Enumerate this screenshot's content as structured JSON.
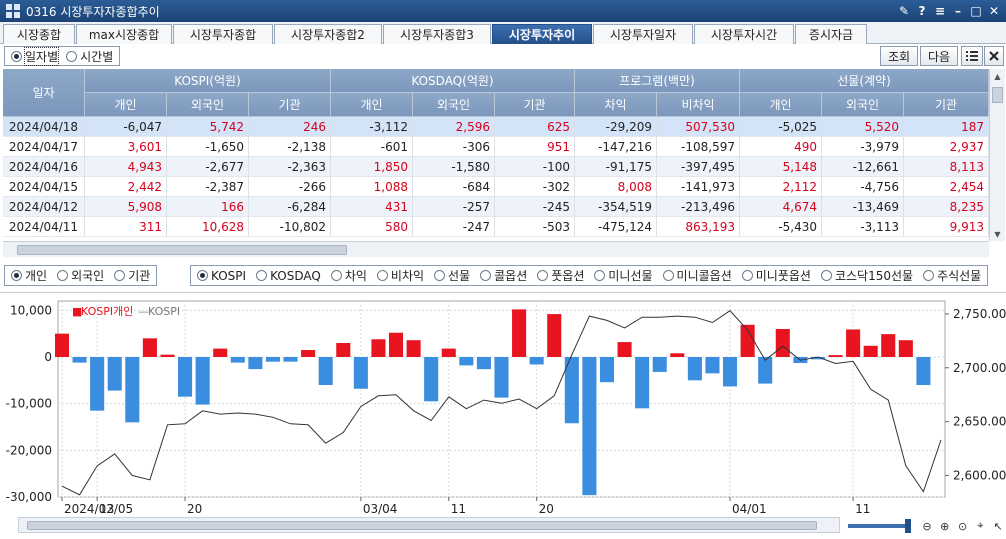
{
  "window": {
    "title": "0316 시장투자자종합추이",
    "buttons": [
      "✎",
      "?",
      "≡",
      "–",
      "□",
      "✕"
    ]
  },
  "tabs": [
    {
      "label": "시장종합",
      "active": false
    },
    {
      "label": "max시장종합",
      "active": false
    },
    {
      "label": "시장투자종합",
      "active": false
    },
    {
      "label": "시장투자종합2",
      "active": false
    },
    {
      "label": "시장투자종합3",
      "active": false
    },
    {
      "label": "시장투자추이",
      "active": true
    },
    {
      "label": "시장투자일자",
      "active": false
    },
    {
      "label": "시장투자시간",
      "active": false
    },
    {
      "label": "증시자금",
      "active": false
    }
  ],
  "toolbar": {
    "radios": [
      {
        "label": "일자별",
        "checked": true
      },
      {
        "label": "시간별",
        "checked": false
      }
    ],
    "query_button": "조회",
    "next_button": "다음"
  },
  "table": {
    "date_header": "일자",
    "groups": [
      {
        "label": "KOSPI(억원)",
        "cols": [
          "개인",
          "외국인",
          "기관"
        ]
      },
      {
        "label": "KOSDAQ(억원)",
        "cols": [
          "개인",
          "외국인",
          "기관"
        ]
      },
      {
        "label": "프로그램(백만)",
        "cols": [
          "차익",
          "비차익"
        ]
      },
      {
        "label": "선물(계약)",
        "cols": [
          "개인",
          "외국인",
          "기관"
        ]
      }
    ],
    "rows": [
      {
        "date": "2024/04/18",
        "values": [
          "-6,047",
          "5,742",
          "246",
          "-3,112",
          "2,596",
          "625",
          "-29,209",
          "507,530",
          "-5,025",
          "5,520",
          "187"
        ]
      },
      {
        "date": "2024/04/17",
        "values": [
          "3,601",
          "-1,650",
          "-2,138",
          "-601",
          "-306",
          "951",
          "-147,216",
          "-108,597",
          "490",
          "-3,979",
          "2,937"
        ]
      },
      {
        "date": "2024/04/16",
        "values": [
          "4,943",
          "-2,677",
          "-2,363",
          "1,850",
          "-1,580",
          "-100",
          "-91,175",
          "-397,495",
          "5,148",
          "-12,661",
          "8,113"
        ]
      },
      {
        "date": "2024/04/15",
        "values": [
          "2,442",
          "-2,387",
          "-266",
          "1,088",
          "-684",
          "-302",
          "8,008",
          "-141,973",
          "2,112",
          "-4,756",
          "2,454"
        ]
      },
      {
        "date": "2024/04/12",
        "values": [
          "5,908",
          "166",
          "-6,284",
          "431",
          "-257",
          "-245",
          "-354,519",
          "-213,496",
          "4,674",
          "-13,469",
          "8,235"
        ]
      },
      {
        "date": "2024/04/11",
        "values": [
          "311",
          "10,628",
          "-10,802",
          "580",
          "-247",
          "-503",
          "-475,124",
          "863,193",
          "-5,430",
          "-3,113",
          "9,913"
        ]
      }
    ]
  },
  "investor_options": [
    {
      "label": "개인",
      "checked": true
    },
    {
      "label": "외국인",
      "checked": false
    },
    {
      "label": "기관",
      "checked": false
    }
  ],
  "market_options": [
    {
      "label": "KOSPI",
      "checked": true
    },
    {
      "label": "KOSDAQ",
      "checked": false
    },
    {
      "label": "차익",
      "checked": false
    },
    {
      "label": "비차익",
      "checked": false
    },
    {
      "label": "선물",
      "checked": false
    },
    {
      "label": "콜옵션",
      "checked": false
    },
    {
      "label": "풋옵션",
      "checked": false
    },
    {
      "label": "미니선물",
      "checked": false
    },
    {
      "label": "미니콜옵션",
      "checked": false
    },
    {
      "label": "미니풋옵션",
      "checked": false
    },
    {
      "label": "코스닥150선물",
      "checked": false
    },
    {
      "label": "주식선물",
      "checked": false
    }
  ],
  "colors": {
    "positive": "#e8141f",
    "negative": "#3b8de0",
    "line": "#333333"
  },
  "chart_data": {
    "type": "bar",
    "legend": [
      {
        "name": "KOSPI개인",
        "color": "#e8141f",
        "marker": "■"
      },
      {
        "name": "KOSPI",
        "color": "#888888",
        "marker": "—"
      }
    ],
    "x_tick_labels": [
      {
        "index": 0,
        "label": "2024/02/05"
      },
      {
        "index": 2,
        "label": "13"
      },
      {
        "index": 7,
        "label": "20"
      },
      {
        "index": 17,
        "label": "03/04"
      },
      {
        "index": 22,
        "label": "11"
      },
      {
        "index": 27,
        "label": "20"
      },
      {
        "index": 38,
        "label": "04/01"
      },
      {
        "index": 45,
        "label": "11"
      }
    ],
    "series": [
      {
        "name": "KOSPI개인",
        "axis": "left",
        "values": [
          5000,
          -1200,
          -11500,
          -7200,
          -14000,
          4000,
          500,
          -8500,
          -10200,
          1800,
          -1200,
          -2600,
          -1000,
          -1000,
          1500,
          -6000,
          3000,
          -6800,
          3800,
          5200,
          3600,
          -9500,
          1800,
          -1800,
          -2600,
          -8700,
          10200,
          -1600,
          9200,
          -14200,
          -29600,
          -5400,
          3200,
          -11000,
          -3200,
          800,
          -5000,
          -3500,
          -6300,
          6900,
          -5700,
          6000,
          -1300,
          -500,
          400,
          5900,
          2400,
          4900,
          3600,
          -6000
        ]
      },
      {
        "name": "KOSPI",
        "axis": "right",
        "values": [
          2590,
          2582,
          2609,
          2620,
          2600,
          2596,
          2647,
          2648,
          2660,
          2657,
          2658,
          2657,
          2654,
          2648,
          2647,
          2630,
          2640,
          2664,
          2674,
          2675,
          2660,
          2651,
          2673,
          2662,
          2670,
          2667,
          2671,
          2662,
          2674,
          2712,
          2748,
          2744,
          2737,
          2747,
          2747,
          2748,
          2747,
          2742,
          2753,
          2735,
          2707,
          2720,
          2707,
          2710,
          2704,
          2706,
          2680,
          2670,
          2609,
          2585,
          2633
        ]
      }
    ],
    "y_left": {
      "min": -30000,
      "max": 12000,
      "ticks": [
        10000,
        0,
        -10000,
        -20000,
        -30000
      ],
      "tick_labels": [
        "10,000",
        "0",
        "-10,000",
        "-20,000",
        "-30,000"
      ]
    },
    "y_right": {
      "min": 2580,
      "max": 2762,
      "ticks": [
        2750,
        2700,
        2650,
        2600
      ],
      "tick_labels": [
        "2,750.00",
        "2,700.00",
        "2,650.00",
        "2,600.00"
      ]
    },
    "grid": true
  }
}
